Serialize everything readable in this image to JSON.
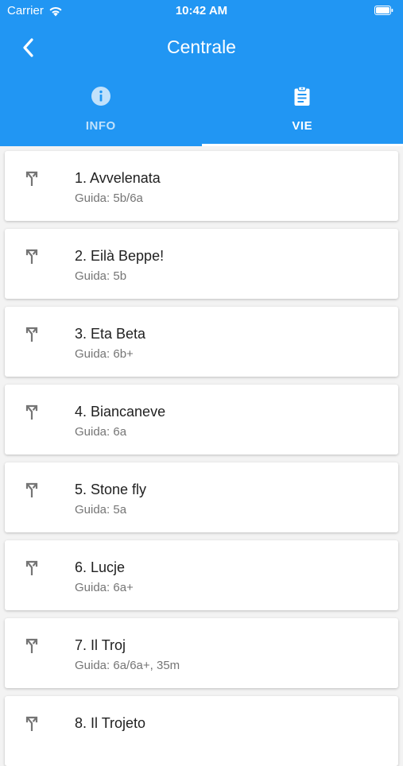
{
  "status_bar": {
    "carrier": "Carrier",
    "time": "10:42 AM"
  },
  "header": {
    "title": "Centrale",
    "back_icon": "chevron-left-icon",
    "color": "#2196f3"
  },
  "tabs": [
    {
      "label": "INFO",
      "icon": "info-icon",
      "selected": false
    },
    {
      "label": "VIE",
      "icon": "clipboard-icon",
      "selected": true
    }
  ],
  "routes": [
    {
      "name": "1. Avvelenata",
      "grade": "Guida: 5b/6a"
    },
    {
      "name": "2. Eilà Beppe!",
      "grade": "Guida: 5b"
    },
    {
      "name": "3. Eta Beta",
      "grade": "Guida: 6b+"
    },
    {
      "name": "4. Biancaneve",
      "grade": "Guida: 6a"
    },
    {
      "name": "5. Stone fly",
      "grade": "Guida: 5a"
    },
    {
      "name": "6. Lucje",
      "grade": "Guida: 6a+"
    },
    {
      "name": "7. Il Troj",
      "grade": "Guida: 6a/6a+, 35m"
    },
    {
      "name": "8. Il Trojeto",
      "grade": ""
    }
  ]
}
